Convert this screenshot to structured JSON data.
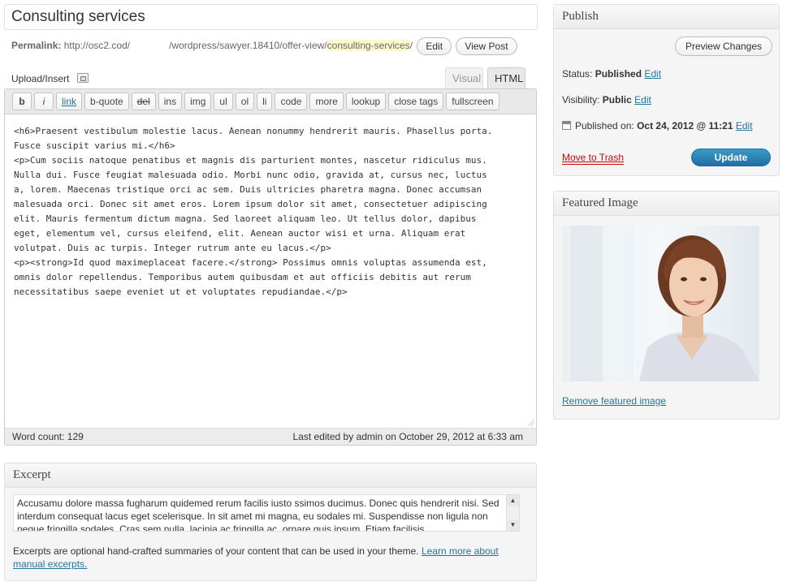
{
  "post": {
    "title": "Consulting services",
    "permalink_label": "Permalink:",
    "permalink_base": "http://osc2.cod/",
    "permalink_path": "/wordpress/sawyer.18410/offer-view/",
    "slug": "consulting-services",
    "permalink_trailing": "/",
    "edit_label": "Edit",
    "view_post_label": "View Post"
  },
  "media": {
    "upload_label": "Upload/Insert",
    "icon": "media-icon"
  },
  "editor": {
    "tabs": [
      "Visual",
      "HTML"
    ],
    "active_tab": "HTML",
    "quicktags": [
      "b",
      "i",
      "link",
      "b-quote",
      "del",
      "ins",
      "img",
      "ul",
      "ol",
      "li",
      "code",
      "more",
      "lookup",
      "close tags",
      "fullscreen"
    ],
    "content": "<h6>Praesent vestibulum molestie lacus. Aenean nonummy hendrerit mauris. Phasellus porta.\nFusce suscipit varius mi.</h6>\n<p>Cum sociis natoque penatibus et magnis dis parturient montes, nascetur ridiculus mus.\nNulla dui. Fusce feugiat malesuada odio. Morbi nunc odio, gravida at, cursus nec, luctus\na, lorem. Maecenas tristique orci ac sem. Duis ultricies pharetra magna. Donec accumsan\nmalesuada orci. Donec sit amet eros. Lorem ipsum dolor sit amet, consectetuer adipiscing\nelit. Mauris fermentum dictum magna. Sed laoreet aliquam leo. Ut tellus dolor, dapibus\neget, elementum vel, cursus eleifend, elit. Aenean auctor wisi et urna. Aliquam erat\nvolutpat. Duis ac turpis. Integer rutrum ante eu lacus.</p>\n<p><strong>Id quod maximeplaceat facere.</strong> Possimus omnis voluptas assumenda est,\nomnis dolor repellendus. Temporibus autem quibusdam et aut officiis debitis aut rerum\nnecessitatibus saepe eveniet ut et voluptates repudiandae.</p>",
    "word_count": "Word count: 129",
    "last_edited": "Last edited by admin on October 29, 2012 at 6:33 am"
  },
  "excerpt": {
    "heading": "Excerpt",
    "text": "Accusamu dolore massa fugharum quidemed rerum facilis iusto ssimos ducimus. Donec quis hendrerit nisi. Sed interdum consequat lacus eget scelerisque. In sit amet mi magna, eu sodales mi. Suspendisse non ligula non neque fringilla sodales. Cras sem nulla, lacinia ac fringilla ac, ornare quis ipsum. Etiam facilisis",
    "help_text": "Excerpts are optional hand-crafted summaries of your content that can be used in your theme. ",
    "help_link": "Learn more about manual excerpts."
  },
  "publish": {
    "heading": "Publish",
    "preview_label": "Preview Changes",
    "status_label": "Status: ",
    "status_value": "Published",
    "visibility_label": "Visibility: ",
    "visibility_value": "Public",
    "published_label": "Published on: ",
    "published_value": "Oct 24, 2012 @ 11:21",
    "edit_label": "Edit",
    "trash_label": "Move to Trash",
    "update_label": "Update"
  },
  "featured": {
    "heading": "Featured Image",
    "remove_label": "Remove featured image"
  },
  "colors": {
    "link": "#21759b",
    "update_button": "#2a85b8",
    "trash": "#bc0b0b",
    "slug_highlight": "#fffbcc"
  }
}
